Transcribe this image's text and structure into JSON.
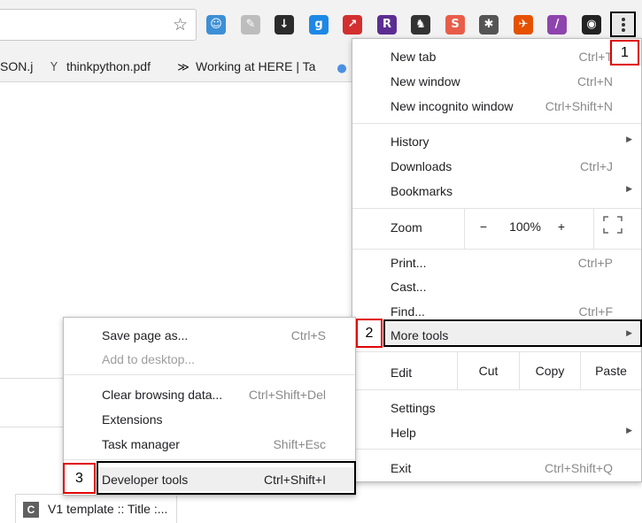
{
  "bookmarks": [
    {
      "label": "SON.j",
      "icon": ""
    },
    {
      "label": "thinkpython.pdf",
      "icon": "y-icon"
    },
    {
      "label": "Working at HERE | Ta",
      "icon": "here-logo-icon"
    }
  ],
  "main_menu": {
    "new_tab": {
      "label": "New tab",
      "shortcut": "Ctrl+T"
    },
    "new_window": {
      "label": "New window",
      "shortcut": "Ctrl+N"
    },
    "new_incognito": {
      "label": "New incognito window",
      "shortcut": "Ctrl+Shift+N"
    },
    "history": {
      "label": "History"
    },
    "downloads": {
      "label": "Downloads",
      "shortcut": "Ctrl+J"
    },
    "bookmarks": {
      "label": "Bookmarks"
    },
    "zoom": {
      "label": "Zoom",
      "minus": "−",
      "value": "100%",
      "plus": "+"
    },
    "print": {
      "label": "Print...",
      "shortcut": "Ctrl+P"
    },
    "cast": {
      "label": "Cast..."
    },
    "find": {
      "label": "Find...",
      "shortcut": "Ctrl+F"
    },
    "more_tools": {
      "label": "More tools"
    },
    "edit": {
      "label": "Edit",
      "cut": "Cut",
      "copy": "Copy",
      "paste": "Paste"
    },
    "settings": {
      "label": "Settings"
    },
    "help": {
      "label": "Help"
    },
    "exit": {
      "label": "Exit",
      "shortcut": "Ctrl+Shift+Q"
    }
  },
  "sub_menu": {
    "save_page": {
      "label": "Save page as...",
      "shortcut": "Ctrl+S"
    },
    "add_desktop": {
      "label": "Add to desktop..."
    },
    "clear_browsing": {
      "label": "Clear browsing data...",
      "shortcut": "Ctrl+Shift+Del"
    },
    "extensions": {
      "label": "Extensions"
    },
    "task_manager": {
      "label": "Task manager",
      "shortcut": "Shift+Esc"
    },
    "developer_tools": {
      "label": "Developer tools",
      "shortcut": "Ctrl+Shift+I"
    }
  },
  "annotations": {
    "step1": "1",
    "step2": "2",
    "step3": "3"
  },
  "tab_chip": {
    "favicon": "C",
    "title": "V1 template :: Title :..."
  },
  "extensions": [
    {
      "name": "robot-icon",
      "glyph": "☺",
      "color": "#3d8fd6"
    },
    {
      "name": "notepad-icon",
      "glyph": "✎",
      "color": "#bdbdbd"
    },
    {
      "name": "download-arrow-icon",
      "glyph": "↓",
      "color": "#2b2b2b"
    },
    {
      "name": "g-logo-icon",
      "glyph": "g",
      "color": "#1e88e5"
    },
    {
      "name": "red-arrow-icon",
      "glyph": "↗",
      "color": "#d32f2f"
    },
    {
      "name": "r-logo-icon",
      "glyph": "R",
      "color": "#5c2d91"
    },
    {
      "name": "evernote-icon",
      "glyph": "♞",
      "color": "#333333"
    },
    {
      "name": "s-logo-icon",
      "glyph": "S",
      "color": "#e85d4a"
    },
    {
      "name": "network-icon",
      "glyph": "✱",
      "color": "#555555"
    },
    {
      "name": "bird-icon",
      "glyph": "✈",
      "color": "#e65100"
    },
    {
      "name": "pen-icon",
      "glyph": "/",
      "color": "#8e44ad"
    },
    {
      "name": "color-wheel-icon",
      "glyph": "◉",
      "color": "#222222"
    }
  ],
  "colors": {
    "annotation_red": "#e00000",
    "outline_black": "#000000"
  }
}
